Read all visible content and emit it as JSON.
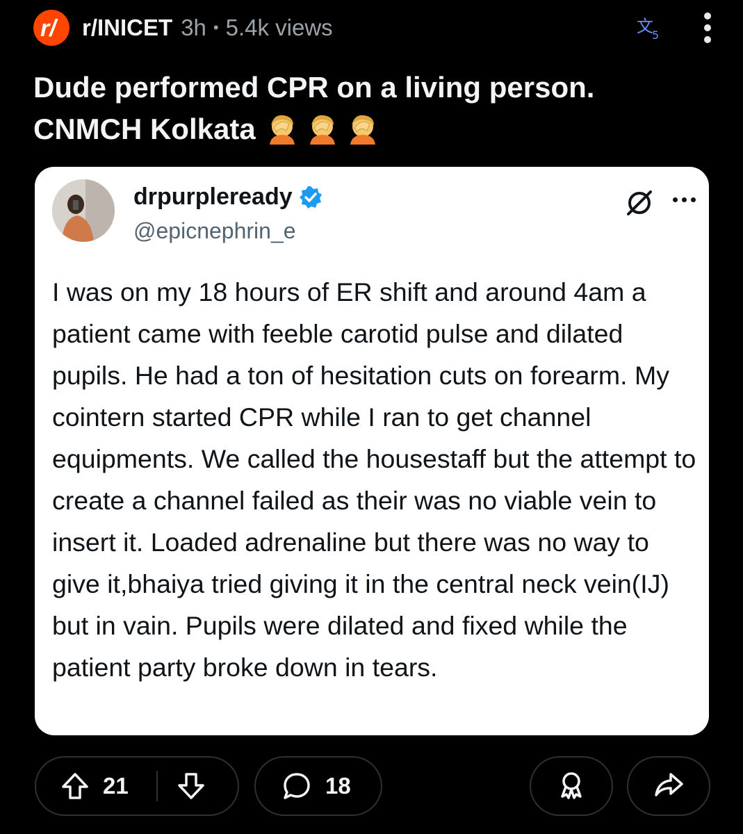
{
  "post": {
    "subreddit": "r/INICET",
    "age": "3h",
    "separator": "•",
    "views": "5.4k views",
    "title": "Dude performed CPR on a living person. CNMCH Kolkata",
    "title_emojis": [
      "facepalm-emoji",
      "facepalm-emoji",
      "facepalm-emoji"
    ]
  },
  "tweet": {
    "display_name": "drpurpleready",
    "handle": "@epicnephrin_e",
    "verified": true,
    "body": "I was on my 18 hours of ER shift and around 4am a patient came with feeble carotid pulse and dilated pupils. He had a ton of hesitation cuts on forearm. My cointern started CPR while I ran to get channel equipments. We called the housestaff but the attempt to create a channel failed as their was no viable vein to insert it. Loaded adrenaline but there was no way to give it,bhaiya tried giving it in the central neck vein(IJ) but in vain. Pupils were dilated and fixed while the patient party broke down in tears."
  },
  "actions": {
    "upvotes": "21",
    "comments": "18"
  },
  "icons": {
    "subreddit": "reddit-r-logo-icon",
    "translate": "translate-icon",
    "menu": "kebab-menu-icon",
    "verified": "verified-badge-icon",
    "grok": "grok-icon",
    "tweet_more": "more-icon",
    "upvote": "upvote-arrow-icon",
    "downvote": "downvote-arrow-icon",
    "comment": "comment-bubble-icon",
    "award": "award-icon",
    "share": "share-arrow-icon"
  },
  "colors": {
    "background": "#000000",
    "brand": "#ff4500",
    "text": "#f2f4f5",
    "muted": "#9ca3a8",
    "card": "#ffffff",
    "verified": "#1d9bf0",
    "translate": "#6a8cff",
    "pill_border": "#2a3236"
  }
}
